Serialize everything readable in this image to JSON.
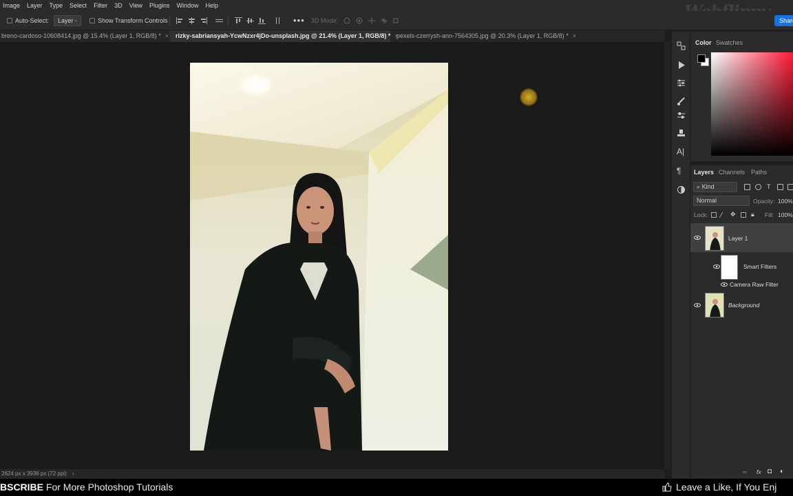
{
  "menubar": {
    "items": [
      "Image",
      "Layer",
      "Type",
      "Select",
      "Filter",
      "3D",
      "View",
      "Plugins",
      "Window",
      "Help"
    ]
  },
  "watermark": "Webflippy",
  "share_label": "Share",
  "options": {
    "auto_select": "Auto-Select:",
    "layer_select": "Layer",
    "show_transform": "Show Transform Controls",
    "three_d_mode": "3D Mode:"
  },
  "tabs": [
    {
      "label": "breno-cardoso-10608414.jpg @ 15.4% (Layer 1, RGB/8) *",
      "close": "×"
    },
    {
      "label": "rizky-sabriansyah-YcwNzxr4jDo-unsplash.jpg @ 21.4% (Layer 1, RGB/8) *",
      "close": "×"
    },
    {
      "label": "pexels-czerrysh-ann-7564305.jpg @ 20.3% (Layer 1, RGB/8) *",
      "close": "×"
    }
  ],
  "color_panel": {
    "tab_color": "Color",
    "tab_swatches": "Swatches",
    "foreground": "#000000",
    "background": "#ffffff",
    "hue": "#ff1a38"
  },
  "layers_panel": {
    "tab_layers": "Layers",
    "tab_channels": "Channels",
    "tab_paths": "Paths",
    "kind": "Kind",
    "blend_mode": "Normal",
    "opacity_label": "Opacity:",
    "opacity_value": "100%",
    "lock_label": "Lock:",
    "fill_label": "Fill:",
    "fill_value": "100%",
    "layers": [
      {
        "name": "Layer 1"
      },
      {
        "name": "Smart Filters"
      },
      {
        "name": "Camera Raw Filter"
      },
      {
        "name": "Background"
      }
    ]
  },
  "status": {
    "doc_size": "2624 px x 3936 px (72 ppi)",
    "arrow": "›"
  },
  "banner": {
    "left_bold": "BSCRIBE",
    "left_rest": "For More Photoshop Tutorials",
    "right": "Leave a Like, If You Enj"
  }
}
